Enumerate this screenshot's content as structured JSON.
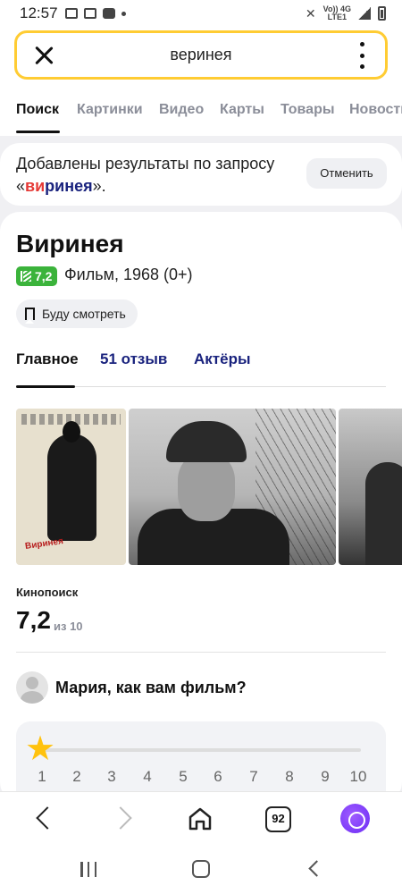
{
  "status_bar": {
    "time": "12:57",
    "network_top": "Vo)) 4G",
    "network_bottom": "LTE1"
  },
  "search": {
    "query": "веринея"
  },
  "tabs": [
    "Поиск",
    "Картинки",
    "Видео",
    "Карты",
    "Товары",
    "Новости"
  ],
  "spell": {
    "prefix": "Добавлены результаты по запросу «",
    "query_start": "ви",
    "query_rest": "ринея",
    "suffix": "».",
    "cancel_label": "Отменить"
  },
  "movie": {
    "title": "Виринея",
    "rating_badge": "7,2",
    "subtitle": "Фильм, 1968 (0+)",
    "watch_later": "Буду смотреть",
    "content_tabs": {
      "main": "Главное",
      "reviews": "51 отзыв",
      "actors": "Актёры"
    },
    "poster_title": "Виринея",
    "kinopoisk_label": "Кинопоиск",
    "kinopoisk_score": "7,2",
    "kinopoisk_scale": "из 10"
  },
  "prompt": {
    "question": "Мария, как вам фильм?"
  },
  "rating_scale": [
    "1",
    "2",
    "3",
    "4",
    "5",
    "6",
    "7",
    "8",
    "9",
    "10"
  ],
  "browser_bar": {
    "tabs_count": "92"
  },
  "colors": {
    "search_border": "#ffcc33",
    "rating_green": "#3bb33b",
    "link_blue": "#1a237e",
    "star": "#ffc20e",
    "alice": "#7b3cf5"
  }
}
